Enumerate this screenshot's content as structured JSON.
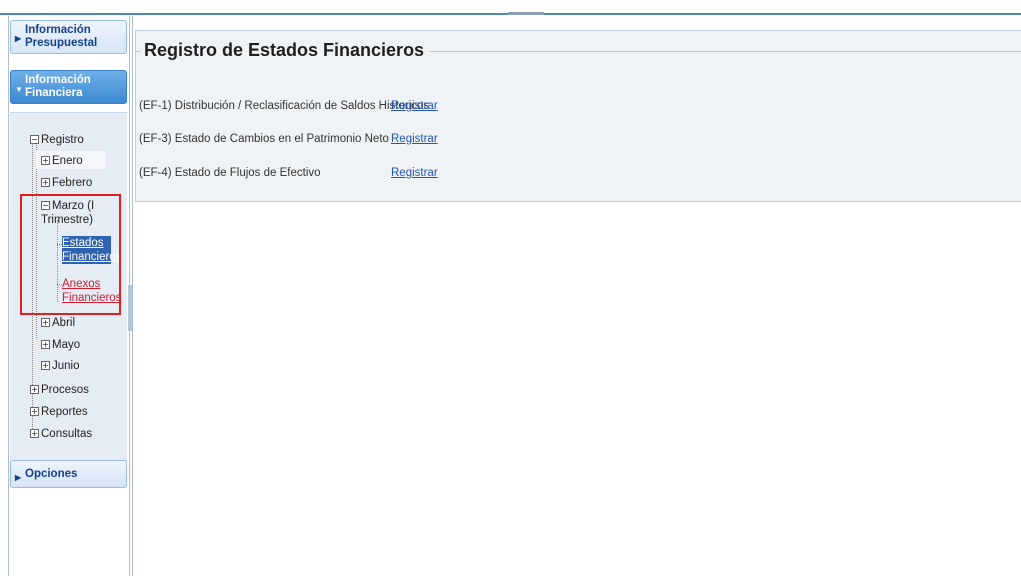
{
  "sidebar": {
    "sections": [
      {
        "label": "Información Presupuestal",
        "state": "collapsed"
      },
      {
        "label": "Información Financiera",
        "state": "expanded"
      },
      {
        "label": "Opciones",
        "state": "collapsed"
      }
    ],
    "tree": {
      "root": "Registro",
      "months": [
        "Enero",
        "Febrero",
        "Marzo (I Trimestre)",
        "Abril",
        "Mayo",
        "Junio"
      ],
      "marzo_children": [
        "Estados Financieros",
        "Anexos Financieros"
      ],
      "others": [
        "Procesos",
        "Reportes",
        "Consultas"
      ]
    }
  },
  "main": {
    "title": "Registro de Estados Financieros",
    "rows": [
      {
        "label": "(EF-1) Distribución / Reclasificación de Saldos Historicos",
        "action": "Registrar"
      },
      {
        "label": "(EF-3) Estado de Cambios en el Patrimonio Neto",
        "action": "Registrar"
      },
      {
        "label": "(EF-4) Estado de Flujos de Efectivo",
        "action": "Registrar"
      }
    ]
  },
  "colors": {
    "accent": "#4a88c4",
    "highlight": "#e02020",
    "selected": "#2f63b0",
    "link": "#2355b5"
  }
}
